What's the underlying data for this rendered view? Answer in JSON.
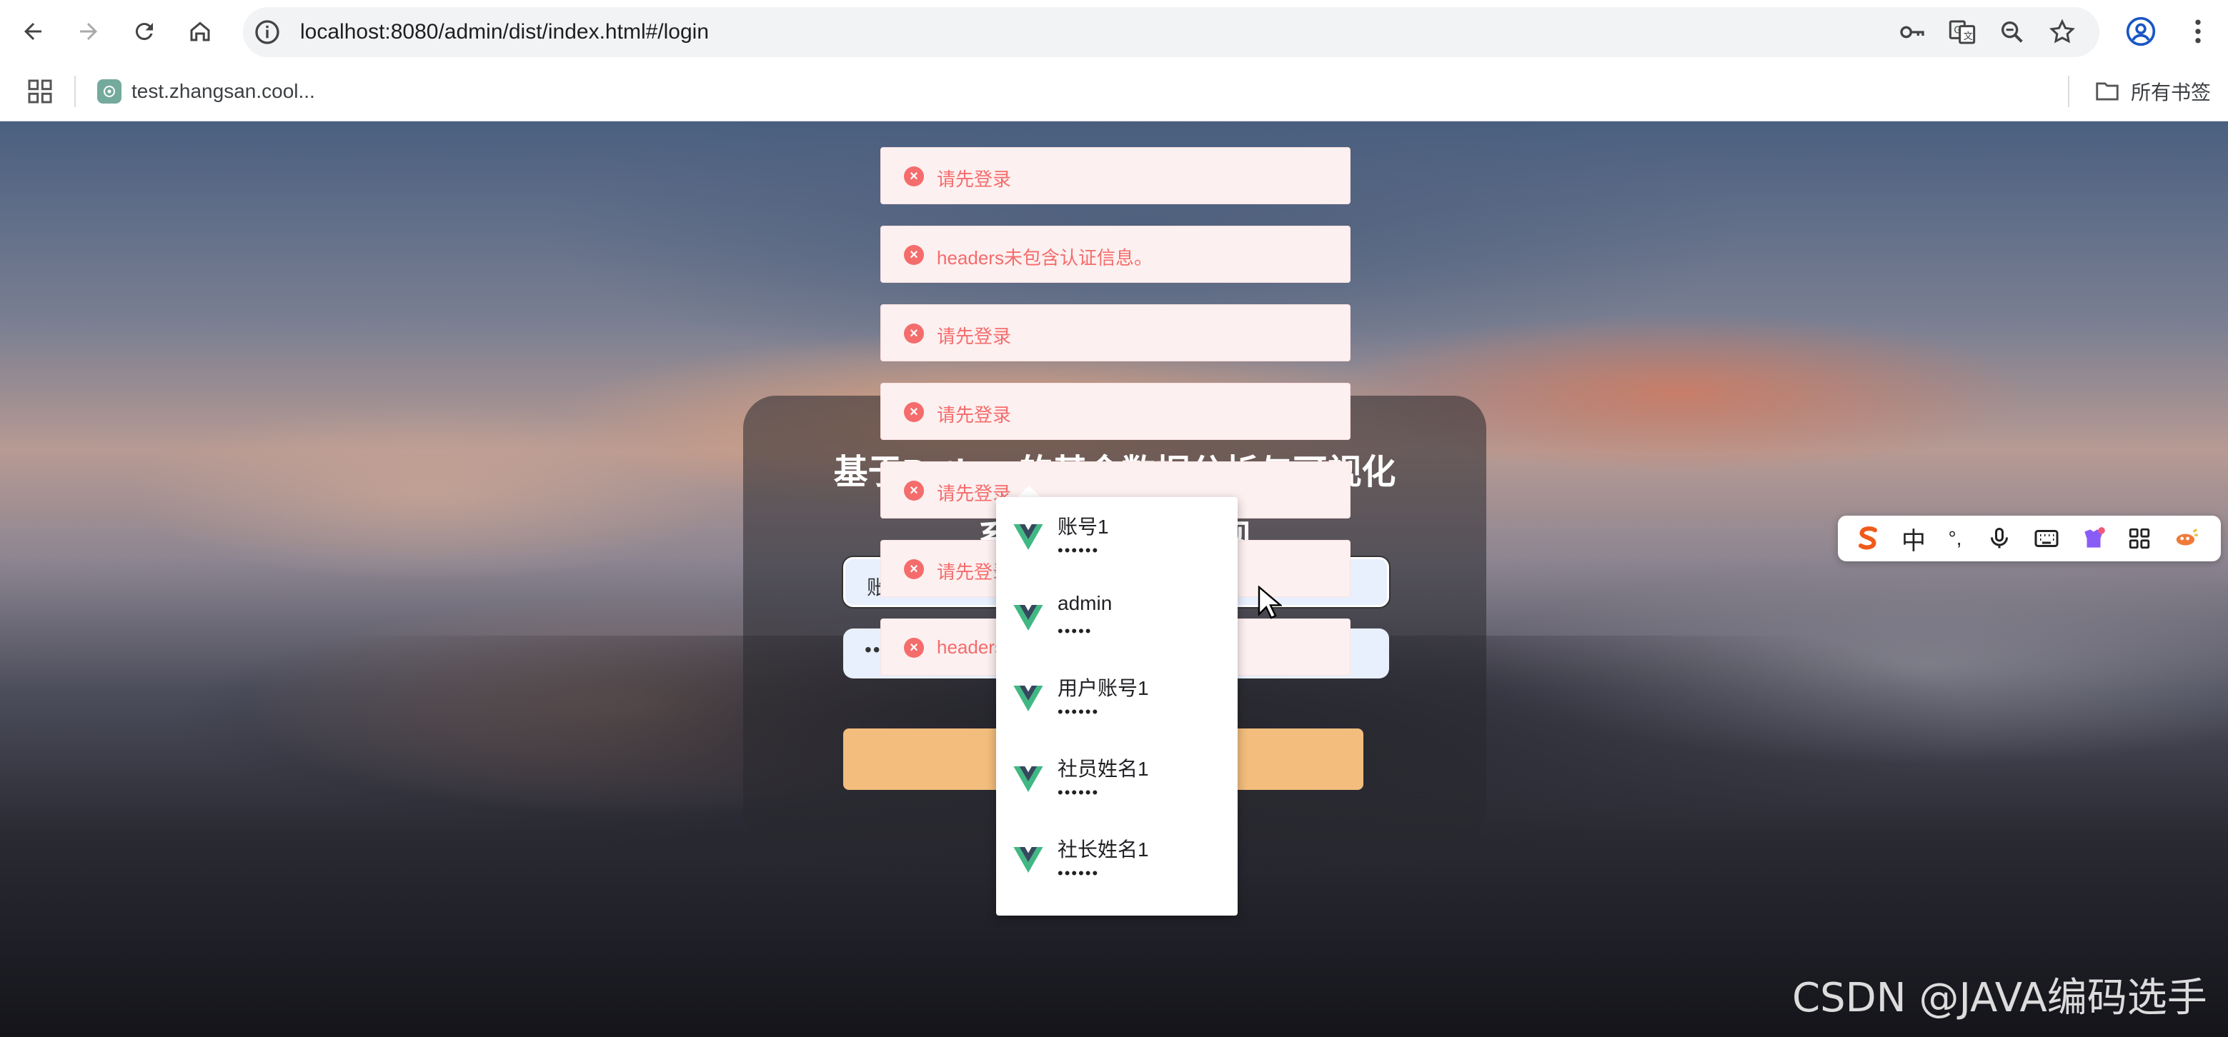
{
  "browser": {
    "url": "localhost:8080/admin/dist/index.html#/login",
    "bookmark_item": "test.zhangsan.cool...",
    "all_bookmarks": "所有书签"
  },
  "login": {
    "title_line1": "基于Python的基金数据分析与可视化",
    "title_line2": "系统的设计与实现",
    "username_value": "账",
    "password_value": "••"
  },
  "toasts": [
    {
      "text": "请先登录"
    },
    {
      "text": "headers未包含认证信息。"
    },
    {
      "text": "请先登录"
    },
    {
      "text": "请先登录"
    },
    {
      "text": "请先登录"
    },
    {
      "text": "请先登录"
    },
    {
      "text": "headers"
    }
  ],
  "autofill": [
    {
      "user": "账号1",
      "pass": "••••••"
    },
    {
      "user": "admin",
      "pass": "•••••"
    },
    {
      "user": "用户账号1",
      "pass": "••••••"
    },
    {
      "user": "社员姓名1",
      "pass": "••••••"
    },
    {
      "user": "社长姓名1",
      "pass": "••••••"
    }
  ],
  "ime": {
    "lang": "中",
    "punct": "°,"
  },
  "watermark": "CSDN @JAVA编码选手",
  "colors": {
    "toast_error": "#f56c6c",
    "login_button": "#f2bd7d"
  }
}
